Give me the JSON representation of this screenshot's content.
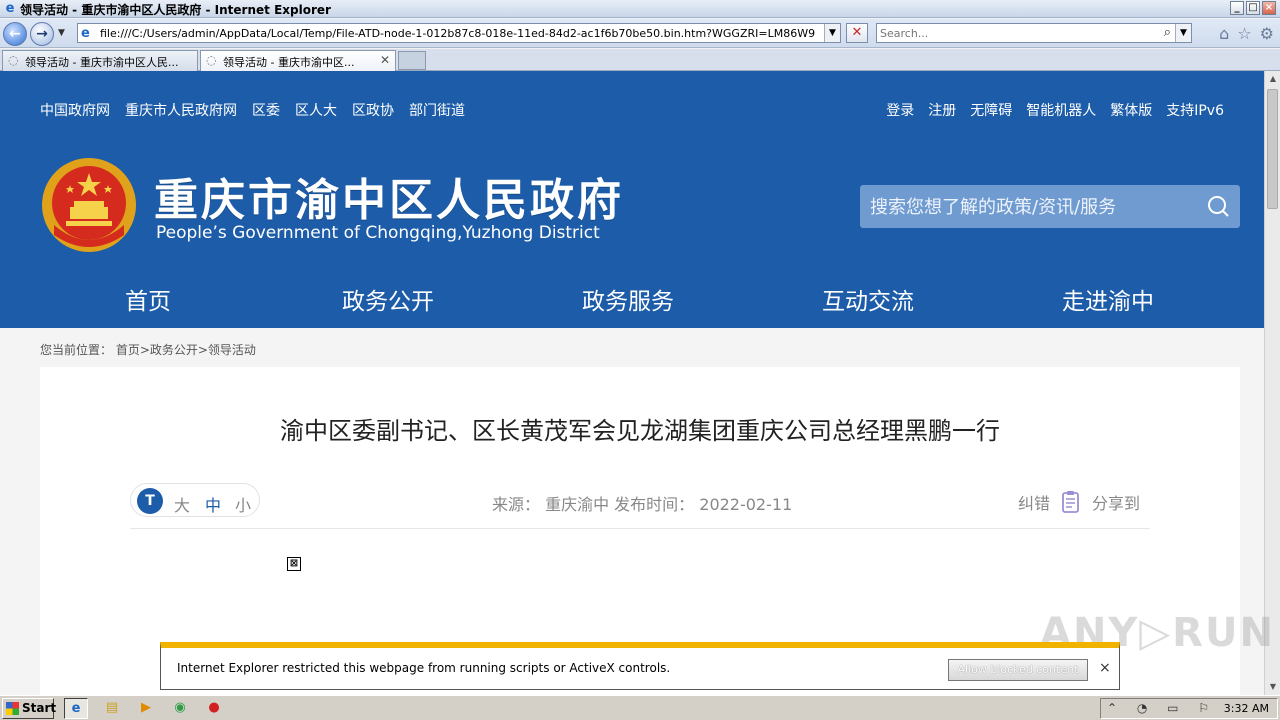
{
  "window": {
    "title": "领导活动 - 重庆市渝中区人民政府 - Internet Explorer",
    "min": "_",
    "max": "□",
    "close": "×"
  },
  "addressbar": {
    "url": "file:///C:/Users/admin/AppData/Local/Temp/File-ATD-node-1-012b87c8-018e-11ed-84d2-ac1f6b70be50.bin.htm?WGGZRI=LM86W9",
    "search_placeholder": "Search..."
  },
  "tabs": [
    {
      "label": "领导活动 - 重庆市渝中区人民..."
    },
    {
      "label": "领导活动 - 重庆市渝中区..."
    }
  ],
  "site": {
    "top_links": [
      "中国政府网",
      "重庆市人民政府网",
      "区委",
      "区人大",
      "区政协",
      "部门街道"
    ],
    "right_links": [
      "登录",
      "注册",
      "无障碍",
      "智能机器人",
      "繁体版",
      "支持IPv6"
    ],
    "name_cn": "重庆市渝中区人民政府",
    "name_en": "People’s Government of Chongqing,Yuzhong District",
    "search_placeholder": "搜索您想了解的政策/资讯/服务",
    "nav": [
      "首页",
      "政务公开",
      "政务服务",
      "互动交流",
      "走进渝中"
    ],
    "breadcrumb": "您当前位置： 首页>政务公开>领导活动"
  },
  "article": {
    "title": "渝中区委副书记、区长黄茂军会见龙湖集团重庆公司总经理黑鹏一行",
    "font_icon": "T",
    "font_big": "大",
    "font_mid": "中",
    "font_small": "小",
    "meta": "来源： 重庆渝中 发布时间： 2022-02-11",
    "correct": "纠错",
    "share": "分享到"
  },
  "infobar": {
    "message": "Internet Explorer restricted this webpage from running scripts or ActiveX controls.",
    "allow_button": "Allow blocked content",
    "close": "×"
  },
  "taskbar": {
    "start": "Start",
    "clock": "3:32 AM"
  },
  "colors": {
    "header_blue": "#1c5ca8",
    "infobar_yellow": "#f0b400"
  }
}
